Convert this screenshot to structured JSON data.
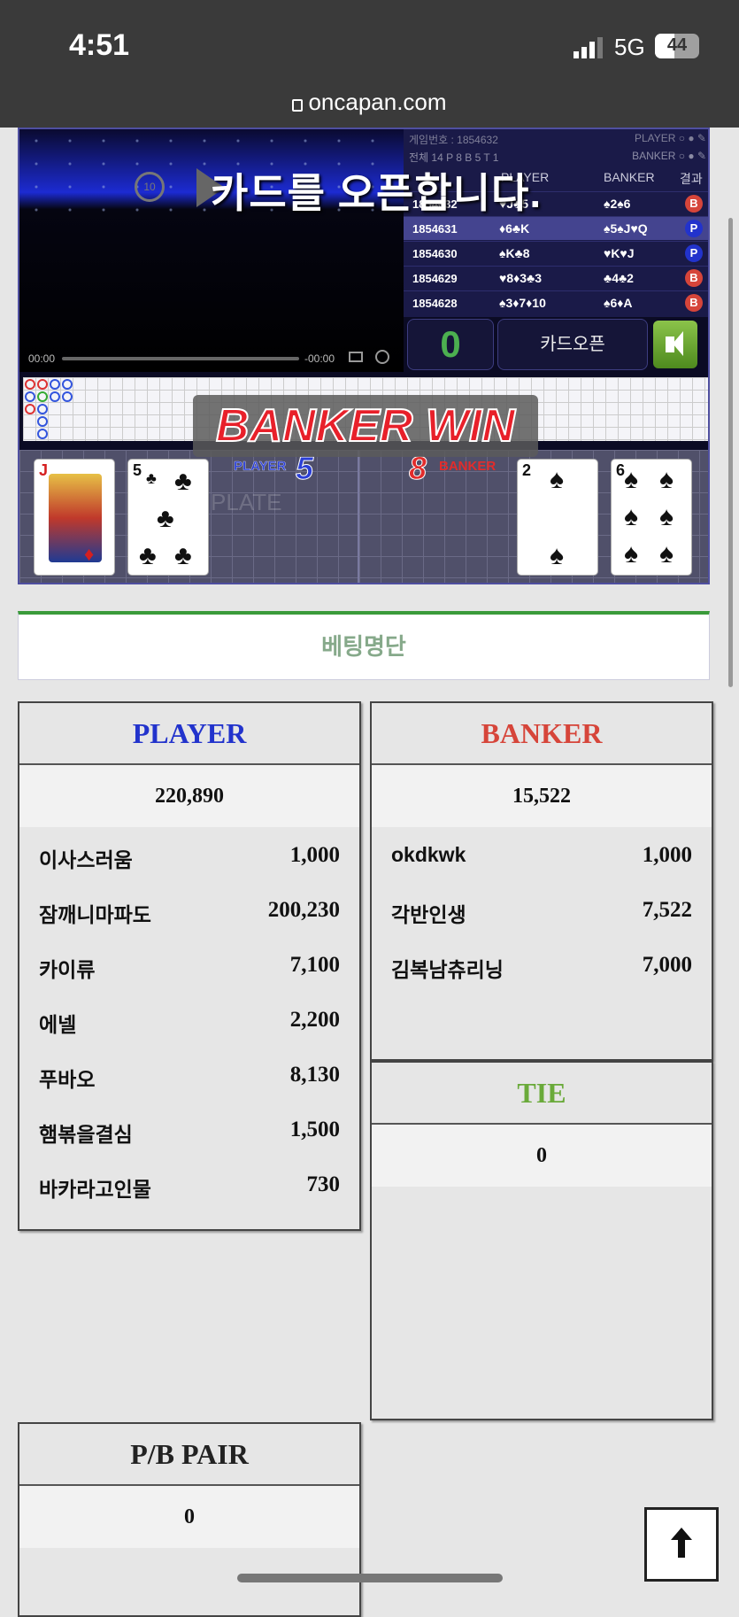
{
  "status_bar": {
    "time": "4:51",
    "network": "5G",
    "battery": "44"
  },
  "browser": {
    "url": "oncapan.com"
  },
  "game": {
    "overlay_message": "카드를 오픈합니다.",
    "video_time_elapsed": "00:00",
    "video_time_remaining": "-00:00",
    "replay_label": "10",
    "history_header_1": "게임번호 : 1854632",
    "history_header_1_right": "PLAYER ○ ● ✎",
    "history_header_2": "전체 14  P 8  B 5  T 1",
    "history_header_2_right": "BANKER ○ ● ✎",
    "history_cols": {
      "player": "PLAYER",
      "banker": "BANKER",
      "result": "결과"
    },
    "history": [
      {
        "num": "1854632",
        "player": "♥J♣5",
        "banker": "♠2♠6",
        "result": "B"
      },
      {
        "num": "1854631",
        "player": "♦6♣K",
        "banker": "♠5♠J♥Q",
        "result": "P"
      },
      {
        "num": "1854630",
        "player": "♠K♣8",
        "banker": "♥K♥J",
        "result": "P"
      },
      {
        "num": "1854629",
        "player": "♥8♦3♣3",
        "banker": "♣4♣2",
        "result": "B"
      },
      {
        "num": "1854628",
        "player": "♠3♦7♦10",
        "banker": "♠6♦A",
        "result": "B"
      }
    ],
    "counter": "0",
    "open_button": "카드오픈",
    "banner": "BANKER WIN",
    "player_label": "PLAYER",
    "player_score": "5",
    "banker_label": "BANKER",
    "banker_score": "8",
    "plate_text": "PLATE",
    "player_cards": [
      {
        "rank": "J",
        "suit": "♦"
      },
      {
        "rank": "5",
        "suit": "♣"
      }
    ],
    "banker_cards": [
      {
        "rank": "2",
        "suit": "♠"
      },
      {
        "rank": "6",
        "suit": "♠"
      }
    ]
  },
  "betting": {
    "title": "베팅명단",
    "player": {
      "title": "PLAYER",
      "total": "220,890",
      "rows": [
        {
          "name": "이사스러움",
          "amount": "1,000"
        },
        {
          "name": "잠깨니마파도",
          "amount": "200,230"
        },
        {
          "name": "카이류",
          "amount": "7,100"
        },
        {
          "name": "에넬",
          "amount": "2,200"
        },
        {
          "name": "푸바오",
          "amount": "8,130"
        },
        {
          "name": "햄볶을결심",
          "amount": "1,500"
        },
        {
          "name": "바카라고인물",
          "amount": "730"
        }
      ]
    },
    "banker": {
      "title": "BANKER",
      "total": "15,522",
      "rows": [
        {
          "name": "okdkwk",
          "amount": "1,000"
        },
        {
          "name": "각반인생",
          "amount": "7,522"
        },
        {
          "name": "김복남츄리닝",
          "amount": "7,000"
        }
      ]
    },
    "tie": {
      "title": "TIE",
      "total": "0"
    },
    "pair": {
      "title": "P/B PAIR",
      "total": "0"
    }
  },
  "colors": {
    "player": "#2233cc",
    "banker": "#d6453a",
    "tie": "#6aaa3a",
    "accent_green": "#3a9a3a"
  }
}
